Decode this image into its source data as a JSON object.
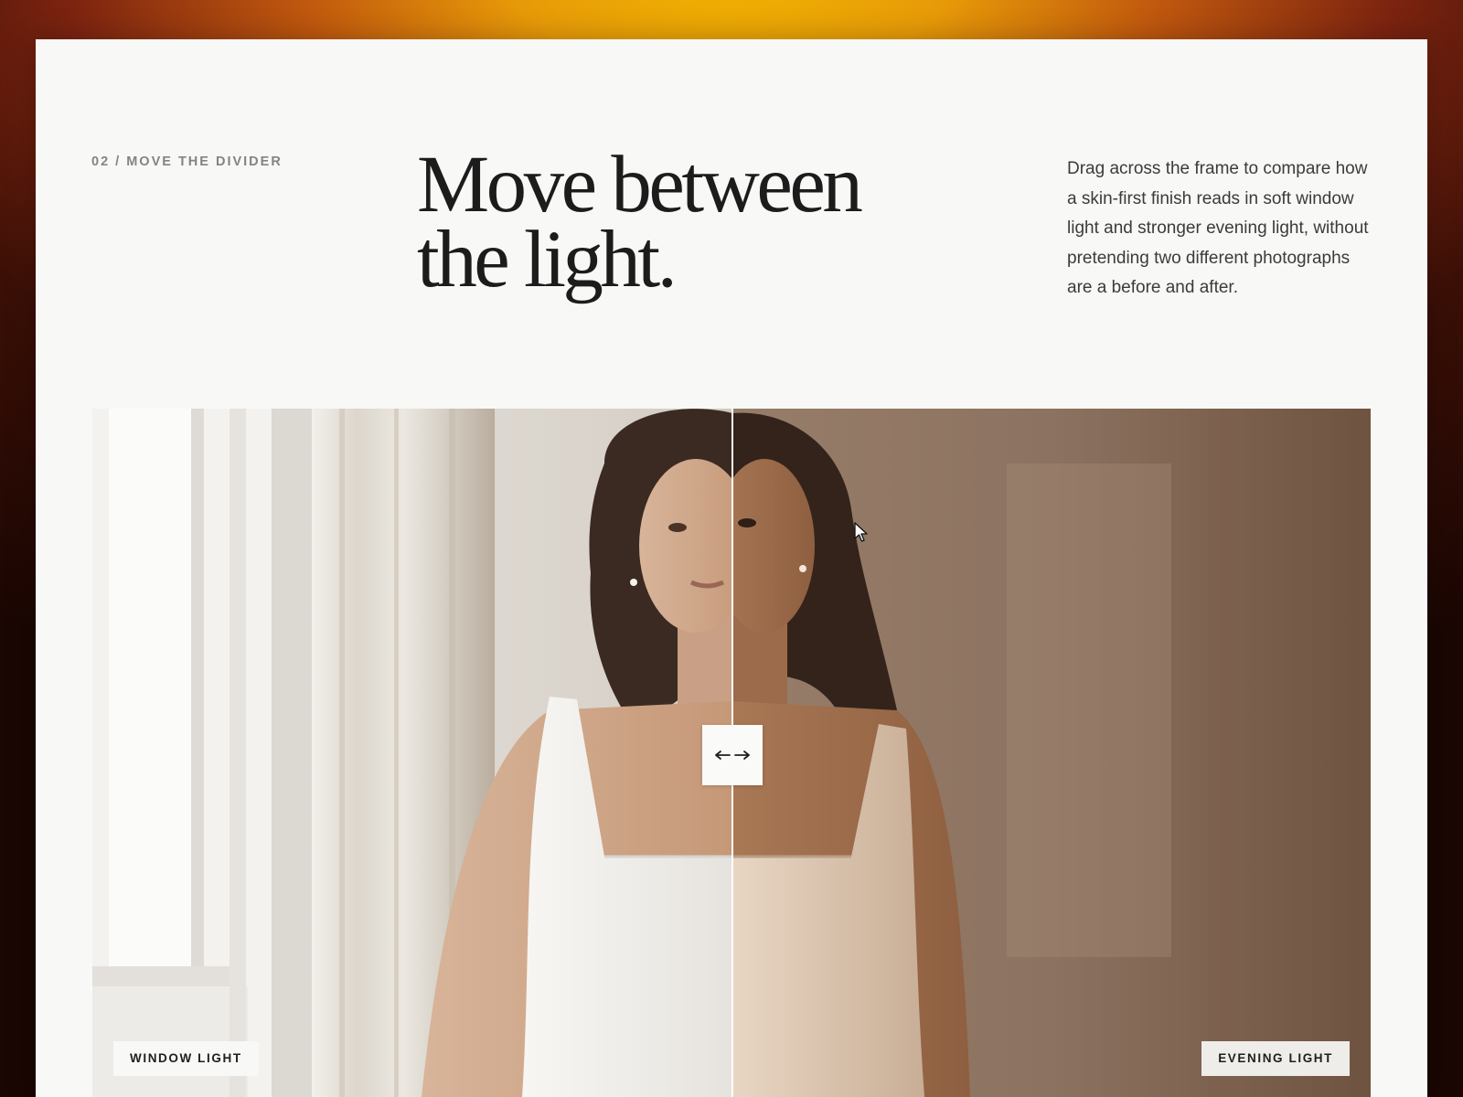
{
  "section": {
    "eyebrow": "02 / MOVE THE DIVIDER",
    "headline_line_1": "Move between",
    "headline_line_2": "the light.",
    "description": "Drag across the frame to compare how a skin-first finish reads in soft window light and stronger evening light, without pretending two different photographs are a before and after."
  },
  "comparison": {
    "left_label": "WINDOW LIGHT",
    "right_label": "EVENING LIGHT",
    "divider_position_percent": 50,
    "handle_icon": "left-right-arrows-icon"
  },
  "colors": {
    "page_background": "#f8f8f6",
    "headline": "#1c1c1c",
    "eyebrow": "#85857f",
    "body_text": "#3b3b38",
    "desktop_glow": "#f2b800"
  }
}
